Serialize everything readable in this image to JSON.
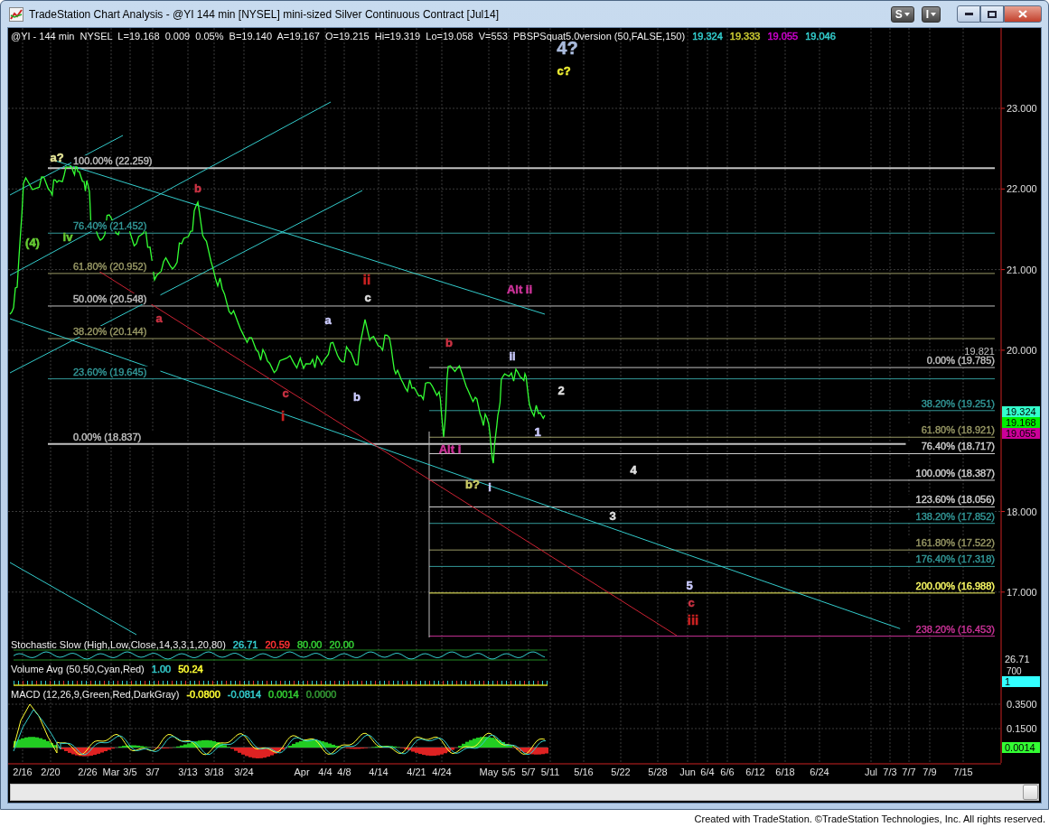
{
  "window": {
    "title": "TradeStation Chart Analysis - @YI 144 min [NYSEL] mini-sized Silver Continuous Contract [Jul14]",
    "buttons": [
      "S",
      "I"
    ]
  },
  "chart": {
    "header": "@YI - 144 min  NYSEL  L=19.168  0.009  0.05%  B=19.140  A=19.167  O=19.215  Hi=19.319  Lo=19.058  V=553  PBSPSquat5.0version (50,FALSE,150)",
    "readings": [
      {
        "text": "19.324",
        "color": "#33cccc"
      },
      {
        "text": "19.333",
        "color": "#cccc33"
      },
      {
        "text": "19.055",
        "color": "#cc00cc"
      },
      {
        "text": "19.046",
        "color": "#33cccc"
      }
    ],
    "price_axis": [
      "23.000",
      "22.000",
      "21.000",
      "20.000",
      "18.000",
      "17.000"
    ],
    "price_markers": [
      {
        "text": "19.324",
        "color": "#33ffcc"
      },
      {
        "text": "19.168",
        "color": "#00ee00"
      },
      {
        "text": "19.055",
        "color": "#cc0099"
      }
    ],
    "retracement_levels": [
      {
        "label": "100.00% (22.259)",
        "color": "#c0c0c0"
      },
      {
        "label": "76.40% (21.452)",
        "color": "#339999"
      },
      {
        "label": "61.80% (20.952)",
        "color": "#999966"
      },
      {
        "label": "50.00% (20.548)",
        "color": "#c0c0c0"
      },
      {
        "label": "38.20% (20.144)",
        "color": "#999966"
      },
      {
        "label": "23.60% (19.645)",
        "color": "#339999"
      },
      {
        "label": "0.00% (18.837)",
        "color": "#c0c0c0"
      }
    ],
    "extension_levels": [
      {
        "label": "0.00% (19.785)",
        "color": "#c0c0c0"
      },
      {
        "label": "38.20% (19.251)",
        "color": "#339999"
      },
      {
        "label": "61.80% (18.921)",
        "color": "#999966"
      },
      {
        "label": "76.40% (18.717)",
        "color": "#d0d0d0"
      },
      {
        "label": "100.00% (18.387)",
        "color": "#d0d0d0"
      },
      {
        "label": "123.60% (18.056)",
        "color": "#d0d0d0"
      },
      {
        "label": "138.20% (17.852)",
        "color": "#339999"
      },
      {
        "label": "161.80% (17.522)",
        "color": "#999966"
      },
      {
        "label": "176.40% (17.318)",
        "color": "#339999"
      },
      {
        "label": "200.00% (16.988)",
        "color": "#ffff66"
      },
      {
        "label": "238.20% (16.453)",
        "color": "#cc3399"
      }
    ],
    "level_note": "19.821",
    "wave_labels": [
      {
        "text": "a?",
        "color": "#e6e699"
      },
      {
        "text": "iv",
        "color": "#66cc33"
      },
      {
        "text": "(4)",
        "color": "#66cc33"
      },
      {
        "text": "b",
        "color": "#cc3344"
      },
      {
        "text": "a",
        "color": "#cc3344"
      },
      {
        "text": "ii",
        "color": "#cc2222"
      },
      {
        "text": "c",
        "color": "#e0e0e0"
      },
      {
        "text": "a",
        "color": "#ccccff"
      },
      {
        "text": "b",
        "color": "#ccccff"
      },
      {
        "text": "c",
        "color": "#cc3344"
      },
      {
        "text": "i",
        "color": "#cc2222"
      },
      {
        "text": "b",
        "color": "#cc3344"
      },
      {
        "text": "ii",
        "color": "#ccccff"
      },
      {
        "text": "2",
        "color": "#e0e0e0"
      },
      {
        "text": "1",
        "color": "#ccccff"
      },
      {
        "text": "Alt ii",
        "color": "#cc3399"
      },
      {
        "text": "Alt i",
        "color": "#cc3399"
      },
      {
        "text": "b?",
        "color": "#cccc66"
      },
      {
        "text": "i",
        "color": "#ccccff"
      },
      {
        "text": "4",
        "color": "#e0e0e0"
      },
      {
        "text": "3",
        "color": "#e0e0e0"
      },
      {
        "text": "5",
        "color": "#ccccff"
      },
      {
        "text": "c",
        "color": "#cc3344"
      },
      {
        "text": "iii",
        "color": "#cc2222"
      },
      {
        "text": "4?",
        "color": "#aabbdd"
      },
      {
        "text": "c?",
        "color": "#eeee33"
      }
    ]
  },
  "stochastic": {
    "label": "Stochastic Slow (High,Low,Close,14,3,3,1,20,80)",
    "readings": [
      {
        "text": "26.71",
        "color": "#33cccc"
      },
      {
        "text": "20.59",
        "color": "#ff3333"
      },
      {
        "text": "80.00",
        "color": "#33cc33"
      },
      {
        "text": "20.00",
        "color": "#33cc33"
      }
    ],
    "axis_marker": "26.71"
  },
  "volume": {
    "label": "Volume Avg (50,50,Cyan,Red)",
    "readings": [
      {
        "text": "1.00",
        "color": "#33cccc"
      },
      {
        "text": "50.24",
        "color": "#ffff33"
      }
    ],
    "axis_label": "700",
    "axis_marker": "1"
  },
  "macd": {
    "label": "MACD (12,26,9,Green,Red,DarkGray)",
    "readings": [
      {
        "text": "-0.0800",
        "color": "#ffff33"
      },
      {
        "text": "-0.0814",
        "color": "#33cccc"
      },
      {
        "text": "0.0014",
        "color": "#33cc33"
      },
      {
        "text": "0.0000",
        "color": "#339933"
      }
    ],
    "axis_labels": [
      "0.3500",
      "0.1500"
    ],
    "axis_marker": "0.0014"
  },
  "date_axis": [
    "2/16",
    "2/20",
    "2/26",
    "Mar",
    "3/5",
    "3/7",
    "3/13",
    "3/18",
    "3/24",
    "Apr",
    "4/4",
    "4/8",
    "4/14",
    "4/21",
    "4/24",
    "May",
    "5/5",
    "5/7",
    "5/11",
    "5/16",
    "5/22",
    "5/28",
    "Jun",
    "6/4",
    "6/6",
    "6/12",
    "6/18",
    "6/24",
    "Jul",
    "7/3",
    "7/7",
    "7/9",
    "7/15"
  ],
  "footer": "Created with TradeStation. ©TradeStation Technologies, Inc. All rights reserved."
}
